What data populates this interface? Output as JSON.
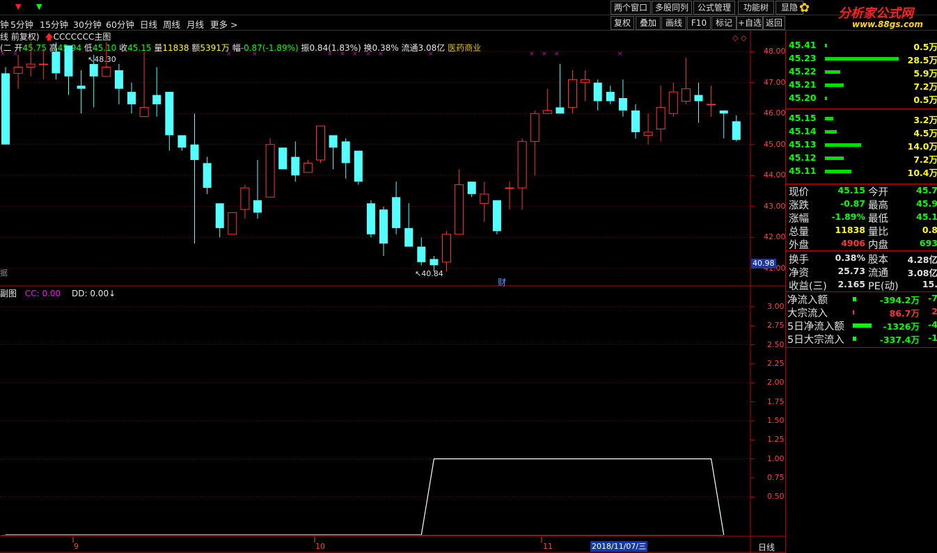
{
  "menu": {
    "down_arrow_red": "▼",
    "down_arrow_green": "▼",
    "right_buttons": [
      "两个窗口",
      "多股同列",
      "公式管理",
      "功能树",
      "显隐"
    ],
    "watermark_title": "分析家公式网",
    "watermark_url": "www.88gs.com"
  },
  "toolbar": {
    "timeframes": [
      "钟",
      "5分钟",
      "15分钟",
      "30分钟",
      "60分钟",
      "日线",
      "周线",
      "月线",
      "更多 >"
    ],
    "buttons": [
      "复权",
      "叠加",
      "画线",
      "F10",
      "标记",
      "+自选",
      "返回"
    ]
  },
  "main_chart": {
    "header_left": "线 前复权)",
    "main_title": "CCCCCCC主图",
    "ohlc_prefix": "(二",
    "open_label": "开",
    "open": "45.75",
    "high_label": "高",
    "high": "45.94",
    "low_label": "低",
    "low": "45.10",
    "close_label": "收",
    "close": "45.15",
    "volume_label": "量",
    "volume": "11838",
    "amount_label": "额",
    "amount": "5391万",
    "change_label": "幅",
    "change": "-0.87(-1.89%)",
    "amplitude_label": "振",
    "amplitude": "0.84(1.83%)",
    "turnover_label": "换",
    "turnover": "0.38%",
    "float_label": "流通",
    "float_cap": "3.08亿",
    "sector": "医药商业",
    "high_marker": "48.30",
    "low_marker": "40.84",
    "finance_marker": "财",
    "crosshair_price": "40.98",
    "bottom_left_text": "据",
    "y_labels": [
      "48.00",
      "47.00",
      "46.00",
      "45.00",
      "44.00",
      "43.00",
      "42.00",
      "41.00"
    ]
  },
  "sub_chart": {
    "title": "副图",
    "cc_label": "CC: 0.00",
    "dd_label": "DD: 0.00",
    "dd_arrow": "↓",
    "y_labels": [
      "3.00",
      "2.75",
      "2.50",
      "2.25",
      "2.00",
      "1.75",
      "1.50",
      "1.25",
      "1.00",
      "0.75",
      "0.50"
    ]
  },
  "date_axis": {
    "labels": [
      "9",
      "10",
      "11"
    ],
    "highlighted_date": "2018/11/07/三",
    "period": "日线"
  },
  "order_book": {
    "asks": [
      {
        "price": "45.41",
        "vol": "0.5万",
        "bar": 0.02
      },
      {
        "price": "45.23",
        "vol": "28.5万",
        "bar": 1.0
      },
      {
        "price": "45.22",
        "vol": "5.9万",
        "bar": 0.21
      },
      {
        "price": "45.21",
        "vol": "7.2万",
        "bar": 0.25
      },
      {
        "price": "45.20",
        "vol": "0.5万",
        "bar": 0.02
      }
    ],
    "bids": [
      {
        "price": "45.15",
        "vol": "3.2万",
        "bar": 0.11
      },
      {
        "price": "45.14",
        "vol": "4.5万",
        "bar": 0.16
      },
      {
        "price": "45.13",
        "vol": "14.0万",
        "bar": 0.49
      },
      {
        "price": "45.12",
        "vol": "7.2万",
        "bar": 0.25
      },
      {
        "price": "45.11",
        "vol": "10.4万",
        "bar": 0.36
      }
    ]
  },
  "quote": {
    "rows": [
      {
        "l1": "现价",
        "v1": "45.15",
        "c1": "#00ff00",
        "l2": "今开",
        "v2": "45.7",
        "c2": "#00ff00"
      },
      {
        "l1": "涨跌",
        "v1": "-0.87",
        "c1": "#00ff00",
        "l2": "最高",
        "v2": "45.9",
        "c2": "#00ff00"
      },
      {
        "l1": "涨幅",
        "v1": "-1.89%",
        "c1": "#00ff00",
        "l2": "最低",
        "v2": "45.1",
        "c2": "#00ff00"
      },
      {
        "l1": "总量",
        "v1": "11838",
        "c1": "#ffff00",
        "l2": "量比",
        "v2": "0.8",
        "c2": "#ffff00"
      },
      {
        "l1": "外盘",
        "v1": "4906",
        "c1": "#ff3232",
        "l2": "内盘",
        "v2": "693",
        "c2": "#00ff00"
      }
    ],
    "rows2": [
      {
        "l1": "换手",
        "v1": "0.38%",
        "c1": "#e0e0e0",
        "l2": "股本",
        "v2": "4.28亿",
        "c2": "#e0e0e0"
      },
      {
        "l1": "净资",
        "v1": "25.73",
        "c1": "#e0e0e0",
        "l2": "流通",
        "v2": "3.08亿",
        "c2": "#e0e0e0"
      },
      {
        "l1": "收益(三)",
        "v1": "2.165",
        "c1": "#e0e0e0",
        "l2": "PE(动)",
        "v2": "15.",
        "c2": "#e0e0e0"
      }
    ]
  },
  "fund_flow": [
    {
      "label": "净流入额",
      "value": "-394.2万",
      "extra": "-7",
      "color": "#00ff00",
      "bar": 0.1
    },
    {
      "label": "大宗流入",
      "value": "86.7万",
      "extra": "2",
      "color": "#ff3232",
      "bar": 0.02
    },
    {
      "label": "5日净流入额",
      "value": "-1326万",
      "extra": "-4",
      "color": "#00ff00",
      "bar": 0.6
    },
    {
      "label": "5日大宗流入",
      "value": "-337.4万",
      "extra": "-1",
      "color": "#00ff00",
      "bar": 0.1
    }
  ],
  "chart_data": {
    "type": "candlestick",
    "y_range": [
      40.5,
      48.5
    ],
    "candles": [
      [
        47.3,
        45.0,
        47.5,
        45.0
      ],
      [
        47.3,
        47.5,
        47.9,
        46.8
      ],
      [
        47.5,
        47.6,
        48.3,
        47.2
      ],
      [
        47.6,
        47.6,
        48.1,
        47.1
      ],
      [
        48.0,
        47.3,
        48.3,
        47.1
      ],
      [
        48.2,
        47.2,
        48.2,
        46.6
      ],
      [
        46.9,
        46.8,
        47.4,
        46.0
      ],
      [
        47.6,
        47.2,
        47.9,
        46.2
      ],
      [
        47.2,
        47.5,
        48.3,
        47.2
      ],
      [
        47.4,
        46.8,
        47.6,
        46.3
      ],
      [
        46.7,
        46.3,
        47.0,
        46.0
      ],
      [
        45.9,
        46.2,
        48.0,
        45.9
      ],
      [
        46.6,
        46.3,
        47.5,
        45.9
      ],
      [
        46.7,
        45.3,
        46.7,
        44.8
      ],
      [
        45.3,
        44.9,
        45.2,
        44.8
      ],
      [
        45.0,
        44.5,
        46.0,
        41.8
      ],
      [
        44.4,
        43.6,
        44.6,
        43.4
      ],
      [
        43.1,
        42.3,
        43.1,
        42.0
      ],
      [
        42.1,
        42.8,
        42.8,
        42.2
      ],
      [
        42.9,
        43.6,
        43.7,
        42.6
      ],
      [
        43.2,
        42.8,
        44.5,
        42.6
      ],
      [
        43.3,
        45.0,
        45.2,
        43.3
      ],
      [
        44.9,
        44.2,
        44.9,
        44.2
      ],
      [
        44.6,
        44.0,
        45.1,
        43.8
      ],
      [
        44.1,
        44.4,
        44.5,
        44.1
      ],
      [
        44.5,
        45.6,
        45.6,
        44.4
      ],
      [
        45.3,
        44.9,
        45.3,
        44.2
      ],
      [
        45.1,
        44.4,
        45.2,
        43.9
      ],
      [
        44.8,
        43.8,
        44.8,
        43.7
      ],
      [
        43.1,
        42.1,
        43.2,
        42.0
      ],
      [
        42.9,
        41.8,
        43.0,
        41.4
      ],
      [
        43.3,
        42.3,
        43.8,
        42.1
      ],
      [
        42.3,
        41.7,
        43.1,
        41.7
      ],
      [
        41.7,
        41.2,
        42.0,
        41.1
      ],
      [
        41.3,
        41.1,
        41.4,
        40.9
      ],
      [
        41.2,
        42.1,
        42.2,
        40.9
      ],
      [
        42.1,
        43.7,
        44.2,
        42.1
      ],
      [
        43.8,
        43.4,
        43.8,
        43.3
      ],
      [
        43.1,
        43.4,
        43.8,
        42.5
      ],
      [
        43.2,
        42.2,
        43.2,
        42.1
      ],
      [
        43.6,
        43.6,
        43.8,
        42.9
      ],
      [
        43.6,
        45.1,
        45.2,
        42.9
      ],
      [
        45.1,
        46.0,
        46.1,
        44.0
      ],
      [
        46.0,
        46.1,
        46.8,
        46.0
      ],
      [
        46.2,
        46.0,
        47.6,
        46.0
      ],
      [
        46.2,
        47.1,
        47.4,
        46.0
      ],
      [
        47.0,
        47.1,
        47.4,
        46.4
      ],
      [
        47.0,
        46.4,
        47.1,
        46.1
      ],
      [
        46.7,
        46.4,
        46.9,
        46.3
      ],
      [
        46.5,
        46.1,
        47.1,
        45.9
      ],
      [
        46.1,
        45.4,
        46.3,
        45.2
      ],
      [
        45.3,
        45.4,
        46.0,
        45.0
      ],
      [
        45.5,
        46.2,
        46.9,
        45.1
      ],
      [
        46.0,
        46.7,
        47.0,
        45.9
      ],
      [
        46.4,
        46.8,
        47.8,
        46.3
      ],
      [
        46.6,
        46.4,
        47.0,
        45.7
      ],
      [
        46.3,
        46.3,
        46.9,
        45.9
      ],
      [
        46.1,
        46.0,
        46.1,
        45.2
      ],
      [
        45.75,
        45.15,
        45.94,
        45.1
      ]
    ],
    "indicator_cc": [
      0,
      0,
      0,
      0,
      0,
      0,
      0,
      0,
      0,
      0,
      0,
      0,
      0,
      0,
      0,
      0,
      0,
      0,
      0,
      0,
      0,
      0,
      0,
      0,
      0,
      0,
      0,
      0,
      0,
      0,
      0,
      0,
      0,
      0,
      1,
      1,
      1,
      1,
      1,
      1,
      1,
      1,
      1,
      1,
      1,
      1,
      1,
      1,
      1,
      1,
      1,
      1,
      1,
      1,
      1,
      1,
      1,
      0
    ],
    "sub_y_range": [
      0,
      3.2
    ]
  }
}
